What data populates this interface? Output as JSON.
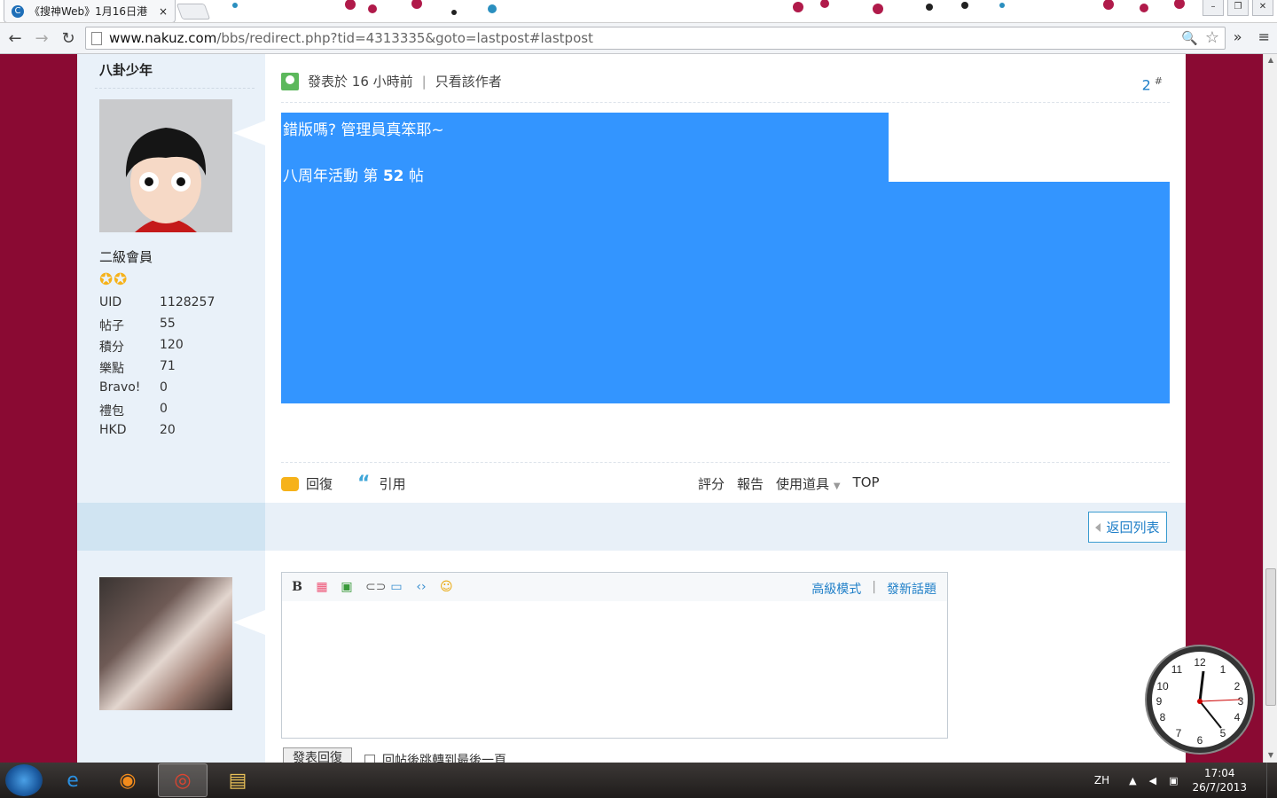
{
  "browser": {
    "tab_title": "《搜神Web》1月16日港",
    "tab_close": "×",
    "url_host": "www.nakuz.com",
    "url_path": "/bbs/redirect.php?tid=4313335&goto=lastpost#lastpost"
  },
  "post": {
    "username": "八卦少年",
    "rank": "二級會員",
    "stats": [
      {
        "key": "UID",
        "value": "1128257"
      },
      {
        "key": "帖子",
        "value": "55"
      },
      {
        "key": "積分",
        "value": "120"
      },
      {
        "key": "樂點",
        "value": "71"
      },
      {
        "key": "Bravo!",
        "value": "0"
      },
      {
        "key": "禮包",
        "value": "0"
      },
      {
        "key": "HKD",
        "value": "20"
      }
    ],
    "posted_prefix": "發表於",
    "posted_time": "16 小時前",
    "author_only": "只看該作者",
    "floor_number": "2",
    "floor_symbol": "#",
    "message_line1": "錯版嗎? 管理員真笨耶~",
    "message_line2_prefix": "八周年活動 第",
    "message_line2_number": "52",
    "message_line2_suffix": "帖"
  },
  "actions": {
    "reply": "回復",
    "quote": "引用",
    "rate": "評分",
    "report": "報告",
    "use_item": "使用道具",
    "top": "TOP"
  },
  "back_to_list": "返回列表",
  "editor": {
    "advanced_mode": "高級模式",
    "new_topic": "發新話題",
    "bold_label": "B",
    "submit_label": "發表回復",
    "jump_label": "回帖後跳轉到最後一頁"
  },
  "taskbar": {
    "lang": "ZH",
    "time": "17:04",
    "date": "26/7/2013"
  }
}
